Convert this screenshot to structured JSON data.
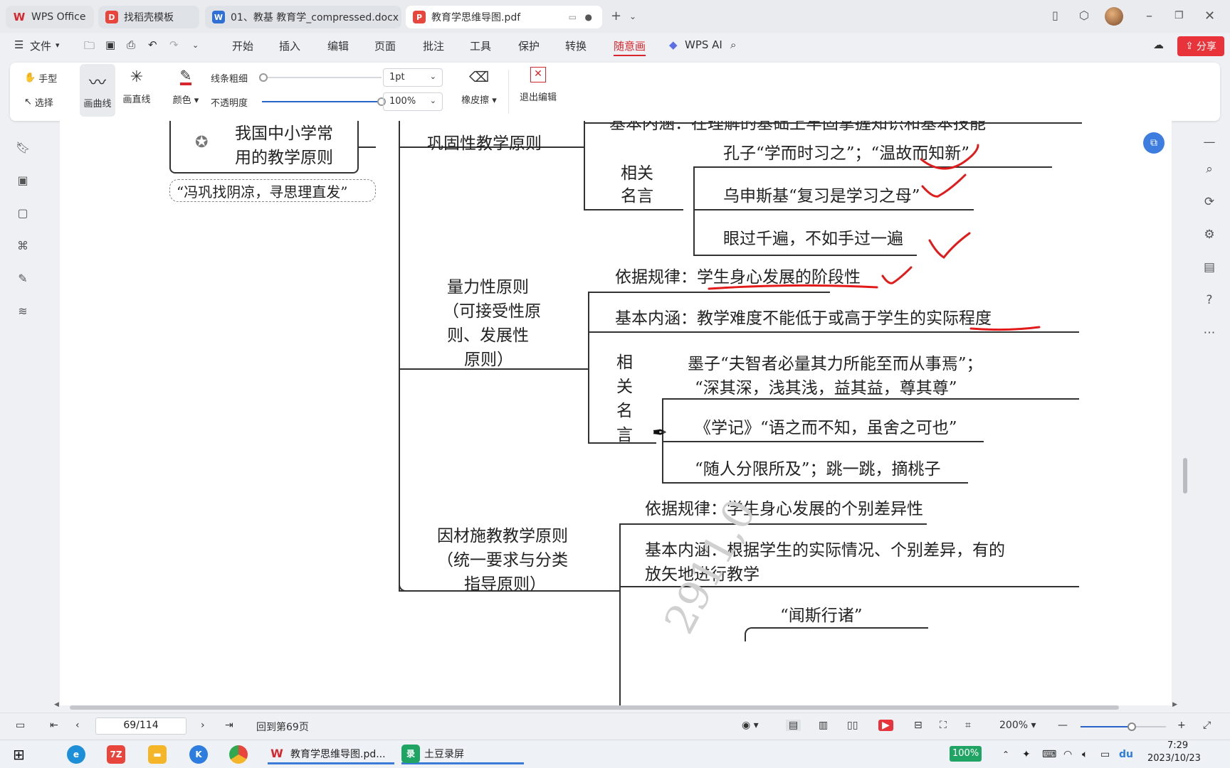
{
  "tabs": [
    {
      "label": "WPS Office",
      "icon": "wps-logo-icon"
    },
    {
      "label": "找稻壳模板",
      "icon": "docer-icon"
    },
    {
      "label": "01、教基  教育学_compressed.docx",
      "icon": "word-doc-icon"
    },
    {
      "label": "教育学思维导图.pdf",
      "icon": "pdf-icon"
    }
  ],
  "menu": {
    "file": "文件",
    "items": [
      "开始",
      "插入",
      "编辑",
      "页面",
      "批注",
      "工具",
      "保护",
      "转换",
      "随意画"
    ],
    "active": "随意画",
    "wps_ai": "WPS AI",
    "share": "分享"
  },
  "toolbar": {
    "hand": "手型",
    "select": "选择",
    "draw_curve": "画曲线",
    "draw_line": "画直线",
    "color": "颜色",
    "line_width_label": "线条粗细",
    "line_width_value": "1pt",
    "opacity_label": "不透明度",
    "opacity_value": "100%",
    "opacity_level": 1.0,
    "line_width_level": 0.0,
    "eraser": "橡皮擦",
    "exit_edit": "退出编辑",
    "pen_color": "#d9262c"
  },
  "document": {
    "root_title_line1": "我国中小学常",
    "root_title_line2": "用的教学原则",
    "mnemonic": "“冯巩找阴凉，寻思理直发”",
    "top_cut_text": "基本内涵：在理解的基础上牢固掌握知识和基本技能",
    "consolidation": "巩固性教学原则",
    "related_quotes_a1": "相关",
    "related_quotes_a2": "名言",
    "quote_confucius": "孔子“学而时习之”；“温故而知新”",
    "quote_ushinsky": "乌申斯基“复习是学习之母”",
    "quote_practice": "眼过千遍，不如手过一遍",
    "capacity_l1": "量力性原则",
    "capacity_l2": "（可接受性原",
    "capacity_l3": "则、发展性",
    "capacity_l4": "原则）",
    "capacity_basis": "依据规律：学生身心发展的阶段性",
    "capacity_meaning": "基本内涵：教学难度不能低于或高于学生的实际程度",
    "related_vertical": [
      "相",
      "关",
      "名",
      "言"
    ],
    "quote_mozi_1": "墨子“夫智者必量其力所能至而从事焉”；",
    "quote_mozi_2": "“深其深，浅其浅，益其益，尊其尊”",
    "quote_xueji": "《学记》“语之而不知，虽舍之可也”",
    "quote_peach": "“随人分限所及”；跳一跳，摘桃子",
    "individual_l1": "因材施教教学原则",
    "individual_l2": "（统一要求与分类",
    "individual_l3": "指导原则）",
    "individual_basis": "依据规律：学生身心发展的个别差异性",
    "individual_meaning_1": "基本内涵：根据学生的实际情况、个别差异，有的",
    "individual_meaning_2": "放矢地进行教学",
    "quote_wensi": "“闻斯行诸”",
    "watermark": "2911,0"
  },
  "statusbar": {
    "page_value": "69/114",
    "back_to_page": "回到第69页",
    "zoom": "200%",
    "zoom_level": 0.6
  },
  "taskbar": {
    "pdf_app": "教育学思维导图.pd...",
    "recorder": "土豆录屏",
    "battery": "100%",
    "time": "7:29",
    "date": "2023/10/23"
  }
}
